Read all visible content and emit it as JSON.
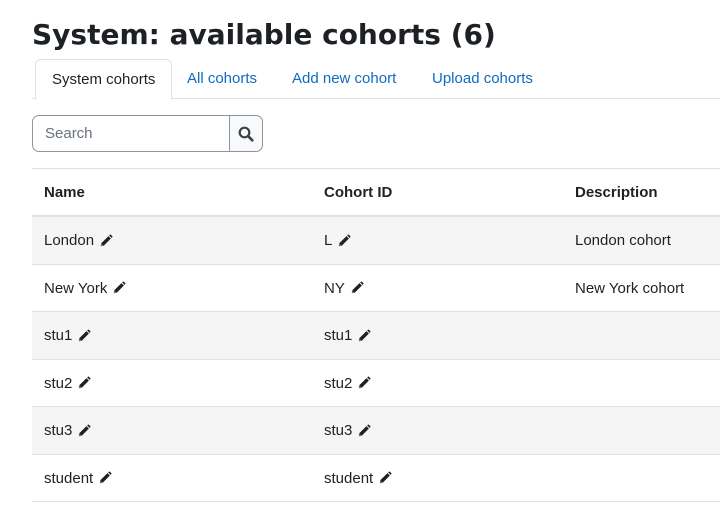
{
  "page": {
    "title": "System: available cohorts (6)"
  },
  "tabs": [
    {
      "label": "System cohorts",
      "active": true
    },
    {
      "label": "All cohorts",
      "active": false
    },
    {
      "label": "Add new cohort",
      "active": false
    },
    {
      "label": "Upload cohorts",
      "active": false
    }
  ],
  "search": {
    "placeholder": "Search",
    "value": "",
    "button_icon": "search-icon"
  },
  "table": {
    "headers": {
      "name": "Name",
      "cohort_id": "Cohort ID",
      "description": "Description"
    },
    "rows": [
      {
        "name": "London",
        "cohort_id": "L",
        "description": "London cohort"
      },
      {
        "name": "New York",
        "cohort_id": "NY",
        "description": "New York cohort"
      },
      {
        "name": "stu1",
        "cohort_id": "stu1",
        "description": ""
      },
      {
        "name": "stu2",
        "cohort_id": "stu2",
        "description": ""
      },
      {
        "name": "stu3",
        "cohort_id": "stu3",
        "description": ""
      },
      {
        "name": "student",
        "cohort_id": "student",
        "description": ""
      }
    ],
    "edit_icon": "pencil-icon"
  },
  "colors": {
    "link": "#0f6cbf",
    "text": "#1d2125",
    "border": "#dee2e6",
    "stripe": "#f5f5f5"
  }
}
